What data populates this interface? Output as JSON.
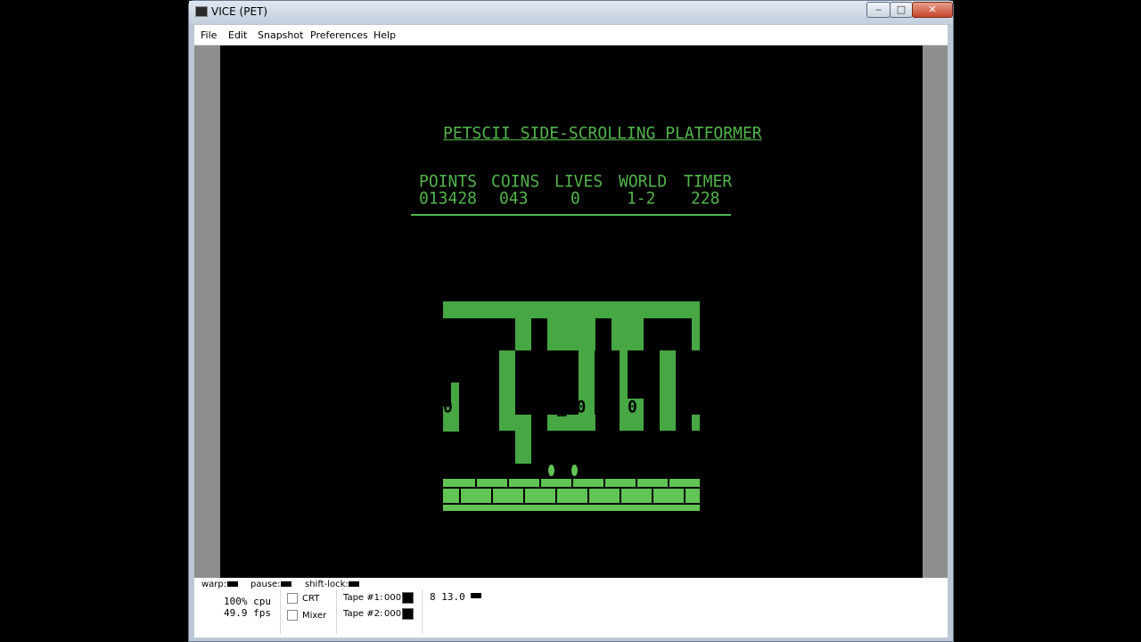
{
  "window": {
    "title": "VICE (PET)",
    "min_glyph": "‒",
    "max_glyph": "□",
    "close_glyph": "✕"
  },
  "menu": [
    "File",
    "Edit",
    "Snapshot",
    "Preferences",
    "Help"
  ],
  "game": {
    "title": "PETSCII SIDE-SCROLLING PLATFORMER",
    "hud_headers": [
      "POINTS",
      "COINS",
      "LIVES",
      "WORLD",
      "TIMER"
    ],
    "hud_values": [
      "013428",
      "043",
      "0",
      "1-2",
      "228"
    ],
    "level_marks": [
      "0",
      "0_00",
      "0"
    ],
    "colors": {
      "phosphor": "#52b34b",
      "block": "#47a744",
      "brick": "#62c455",
      "screen": "#000000"
    }
  },
  "status": {
    "warp_label": "warp:",
    "pause_label": "pause:",
    "shiftlock_label": "shift-lock:",
    "cpu": "100% cpu",
    "fps": "49.9 fps",
    "crt_label": "CRT",
    "mixer_label": "Mixer",
    "tape1_label": "Tape #1:",
    "tape1_value": "000",
    "tape2_label": "Tape #2:",
    "tape2_value": "000",
    "drive": "8 13.0"
  }
}
